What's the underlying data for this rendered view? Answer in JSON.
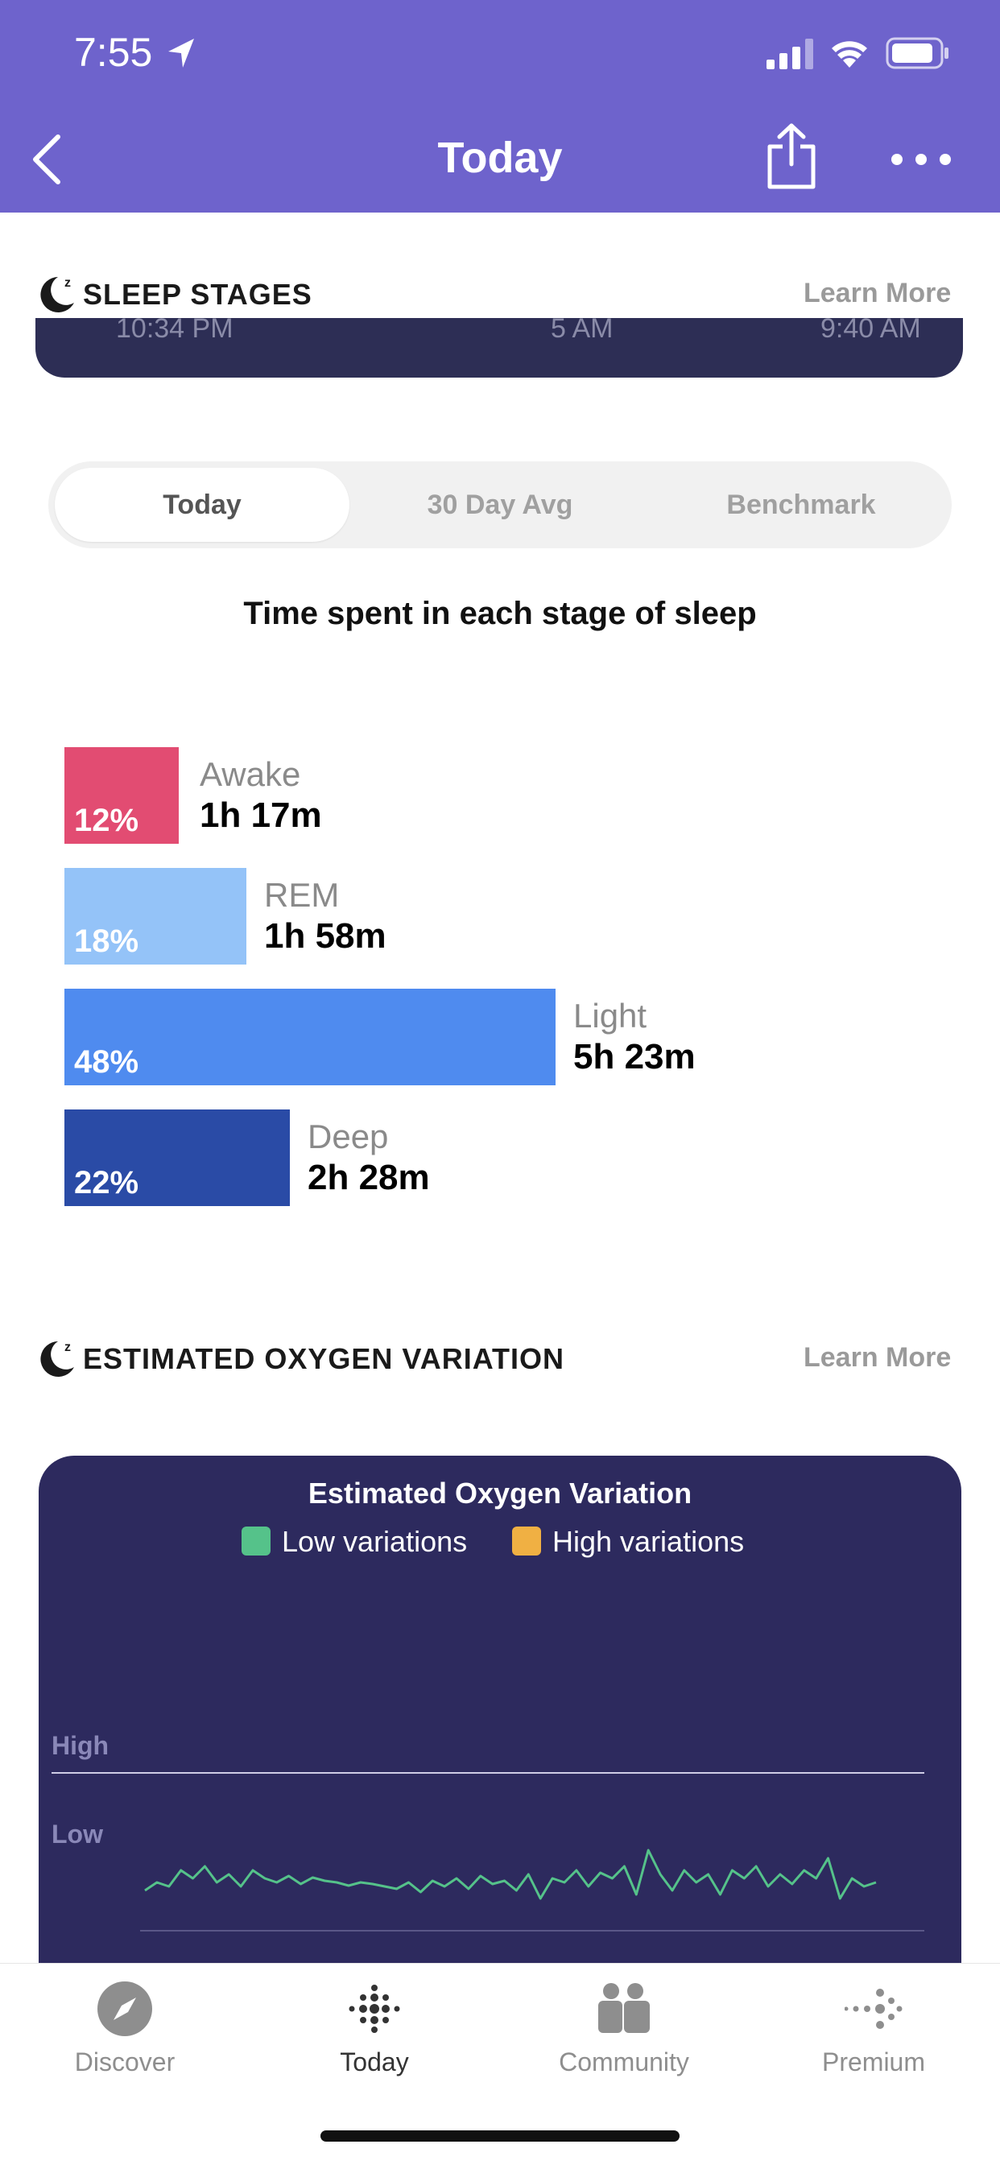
{
  "status_bar": {
    "time": "7:55"
  },
  "header": {
    "title": "Today"
  },
  "sleep_stages": {
    "title": "SLEEP STAGES",
    "learn_more": "Learn More",
    "timeline": {
      "start": "10:34 PM",
      "mid": "5 AM",
      "end": "9:40 AM"
    },
    "tabs": [
      {
        "label": "Today",
        "active": true
      },
      {
        "label": "30 Day Avg",
        "active": false
      },
      {
        "label": "Benchmark",
        "active": false
      }
    ],
    "subtitle": "Time spent in each stage of sleep",
    "stages": [
      {
        "name": "Awake",
        "percent_label": "12%",
        "percent": 12,
        "duration": "1h 17m",
        "color": "#E24C72"
      },
      {
        "name": "REM",
        "percent_label": "18%",
        "percent": 18,
        "duration": "1h 58m",
        "color": "#94C3F8"
      },
      {
        "name": "Light",
        "percent_label": "48%",
        "percent": 48,
        "duration": "5h 23m",
        "color": "#4F8BEF"
      },
      {
        "name": "Deep",
        "percent_label": "22%",
        "percent": 22,
        "duration": "2h 28m",
        "color": "#2A4BA6"
      }
    ]
  },
  "oxygen": {
    "title": "ESTIMATED OXYGEN VARIATION",
    "learn_more": "Learn More",
    "chart_title": "Estimated Oxygen Variation",
    "legend": [
      {
        "label": "Low variations",
        "color": "#55C28A"
      },
      {
        "label": "High variations",
        "color": "#F0B043"
      }
    ],
    "y_labels": {
      "high": "High",
      "low": "Low"
    }
  },
  "chart_data": {
    "type": "line",
    "title": "Estimated Oxygen Variation",
    "ylim": [
      "Low",
      "High"
    ],
    "series": [
      {
        "name": "Low variations",
        "color": "#55C28A",
        "values": [
          0.2,
          0.3,
          0.25,
          0.45,
          0.35,
          0.5,
          0.3,
          0.4,
          0.25,
          0.45,
          0.35,
          0.3,
          0.38,
          0.28,
          0.36,
          0.32,
          0.3,
          0.26,
          0.3,
          0.28,
          0.25,
          0.22,
          0.3,
          0.18,
          0.32,
          0.25,
          0.35,
          0.22,
          0.38,
          0.28,
          0.32,
          0.2,
          0.4,
          0.1,
          0.35,
          0.3,
          0.45,
          0.25,
          0.42,
          0.35,
          0.5,
          0.15,
          0.7,
          0.4,
          0.2,
          0.45,
          0.3,
          0.4,
          0.15,
          0.45,
          0.35,
          0.5,
          0.25,
          0.4,
          0.28,
          0.45,
          0.35,
          0.6,
          0.1,
          0.35,
          0.25,
          0.3
        ]
      }
    ]
  },
  "nav": [
    {
      "label": "Discover",
      "active": false
    },
    {
      "label": "Today",
      "active": true
    },
    {
      "label": "Community",
      "active": false
    },
    {
      "label": "Premium",
      "active": false
    }
  ]
}
